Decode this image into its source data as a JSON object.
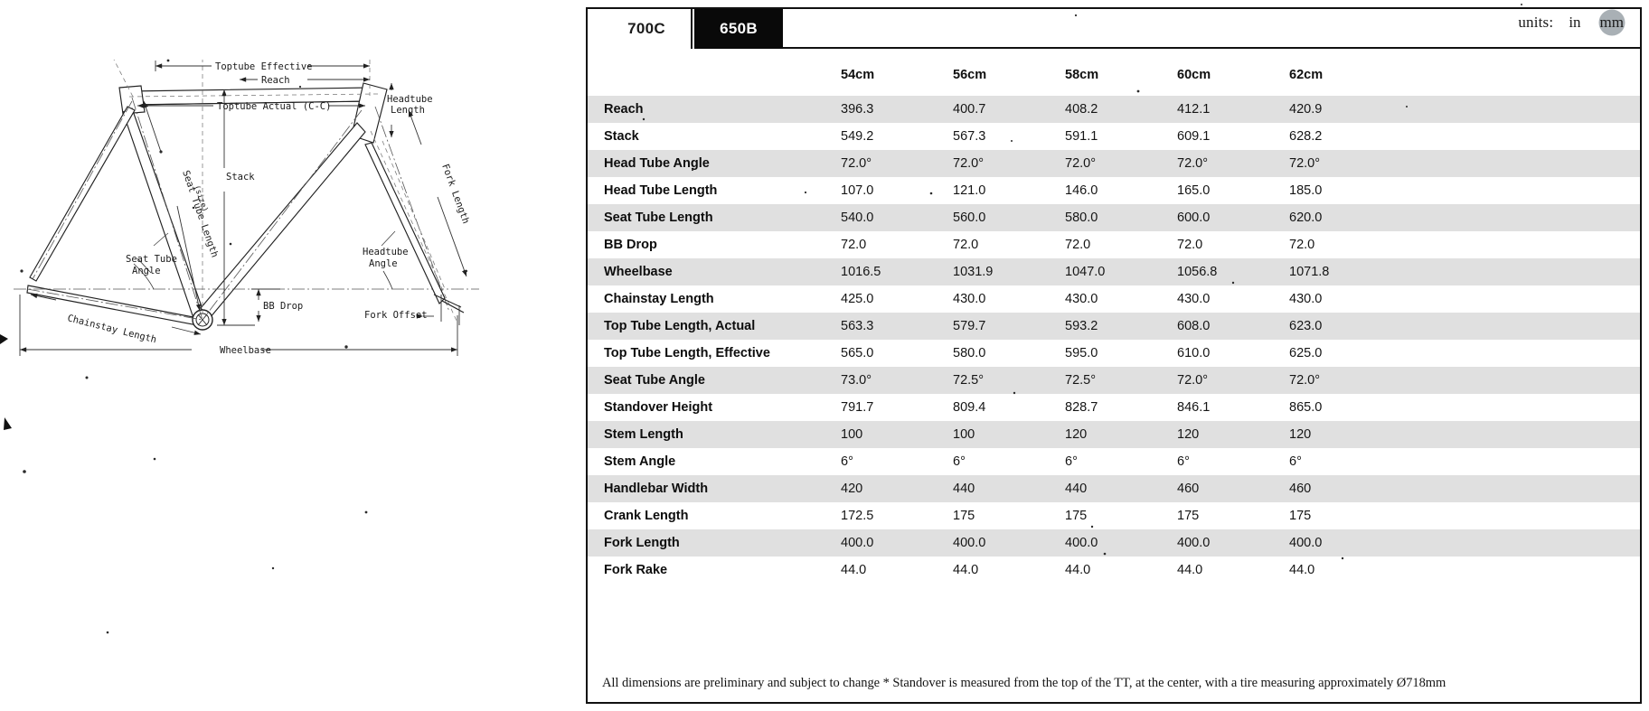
{
  "panel": {
    "tabs": [
      {
        "label": "700C",
        "active": true
      },
      {
        "label": "650B",
        "active": false
      }
    ],
    "units": {
      "label": "units:",
      "options": [
        {
          "label": "in",
          "selected": false
        },
        {
          "label": "mm",
          "selected": true
        }
      ]
    },
    "footnote": "All dimensions are preliminary and subject to change * Standover is measured from the top of the TT, at the center, with a tire measuring approximately Ø718mm"
  },
  "table": {
    "corner_header": "",
    "columns": [
      "54cm",
      "56cm",
      "58cm",
      "60cm",
      "62cm"
    ],
    "rows": [
      {
        "label": "Reach",
        "values": [
          "396.3",
          "400.7",
          "408.2",
          "412.1",
          "420.9"
        ]
      },
      {
        "label": "Stack",
        "values": [
          "549.2",
          "567.3",
          "591.1",
          "609.1",
          "628.2"
        ]
      },
      {
        "label": "Head Tube Angle",
        "values": [
          "72.0°",
          "72.0°",
          "72.0°",
          "72.0°",
          "72.0°"
        ]
      },
      {
        "label": "Head Tube Length",
        "values": [
          "107.0",
          "121.0",
          "146.0",
          "165.0",
          "185.0"
        ]
      },
      {
        "label": "Seat Tube Length",
        "values": [
          "540.0",
          "560.0",
          "580.0",
          "600.0",
          "620.0"
        ]
      },
      {
        "label": "BB Drop",
        "values": [
          "72.0",
          "72.0",
          "72.0",
          "72.0",
          "72.0"
        ]
      },
      {
        "label": "Wheelbase",
        "values": [
          "1016.5",
          "1031.9",
          "1047.0",
          "1056.8",
          "1071.8"
        ]
      },
      {
        "label": "Chainstay Length",
        "values": [
          "425.0",
          "430.0",
          "430.0",
          "430.0",
          "430.0"
        ]
      },
      {
        "label": "Top Tube Length, Actual",
        "values": [
          "563.3",
          "579.7",
          "593.2",
          "608.0",
          "623.0"
        ]
      },
      {
        "label": "Top Tube Length, Effective",
        "values": [
          "565.0",
          "580.0",
          "595.0",
          "610.0",
          "625.0"
        ]
      },
      {
        "label": "Seat Tube Angle",
        "values": [
          "73.0°",
          "72.5°",
          "72.5°",
          "72.0°",
          "72.0°"
        ]
      },
      {
        "label": "Standover Height",
        "values": [
          "791.7",
          "809.4",
          "828.7",
          "846.1",
          "865.0"
        ]
      },
      {
        "label": "Stem Length",
        "values": [
          "100",
          "100",
          "120",
          "120",
          "120"
        ]
      },
      {
        "label": "Stem Angle",
        "values": [
          "6°",
          "6°",
          "6°",
          "6°",
          "6°"
        ]
      },
      {
        "label": "Handlebar Width",
        "values": [
          "420",
          "440",
          "440",
          "460",
          "460"
        ]
      },
      {
        "label": "Crank Length",
        "values": [
          "172.5",
          "175",
          "175",
          "175",
          "175"
        ]
      },
      {
        "label": "Fork Length",
        "values": [
          "400.0",
          "400.0",
          "400.0",
          "400.0",
          "400.0"
        ]
      },
      {
        "label": "Fork Rake",
        "values": [
          "44.0",
          "44.0",
          "44.0",
          "44.0",
          "44.0"
        ]
      }
    ]
  },
  "diagram": {
    "title": "bicycle-frame-geometry-diagram",
    "labels": {
      "toptube_effective": "Toptube Effective",
      "reach": "Reach",
      "toptube_actual": "Toptube Actual (C-C)",
      "headtube_length_1": "Headtube",
      "headtube_length_2": "Length",
      "stack": "Stack",
      "seat_tube_length_1": "Seat Tube Length",
      "seat_tube_length_2": "(size)",
      "fork_length": "Fork Length",
      "seat_tube_angle_1": "Seat Tube",
      "seat_tube_angle_2": "Angle",
      "headtube_angle_1": "Headtube",
      "headtube_angle_2": "Angle",
      "bb_drop": "BB Drop",
      "fork_offset": "Fork Offset",
      "chainstay_length": "Chainstay Length",
      "wheelbase": "Wheelbase"
    }
  }
}
